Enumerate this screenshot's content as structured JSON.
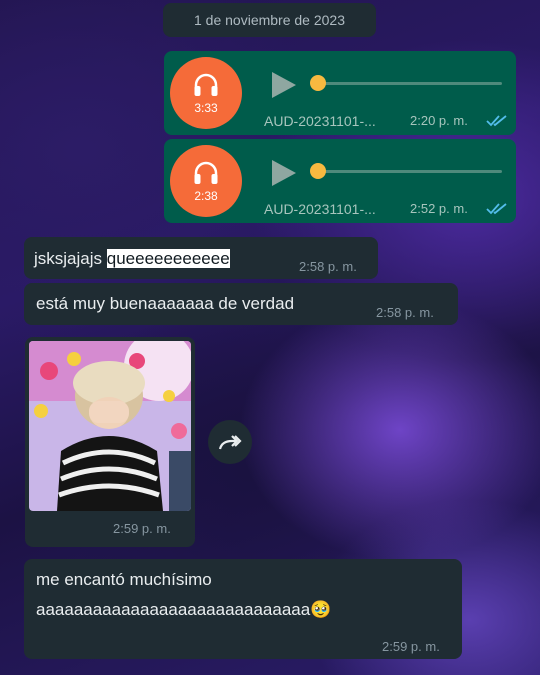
{
  "chat": {
    "date_chip": "1 de noviembre de 2023",
    "audio_messages": [
      {
        "duration": "3:33",
        "filename": "AUD-20231101-...",
        "time": "2:20 p. m.",
        "status": "read",
        "icon": "headphones-icon"
      },
      {
        "duration": "2:38",
        "filename": "AUD-20231101-...",
        "time": "2:52 p. m.",
        "status": "read",
        "icon": "headphones-icon"
      }
    ],
    "text_messages": [
      {
        "text_plain": "jsksjajajs ",
        "text_highlight": "queeeeeeeeeee",
        "time": "2:58 p. m."
      },
      {
        "text": "está muy buenaaaaaaa de verdad",
        "time": "2:58 p. m."
      }
    ],
    "image_message": {
      "time": "2:59 p. m.",
      "forward_icon": "forward-icon"
    },
    "last_message": {
      "line1": "me encantó muchísimo",
      "line2": "aaaaaaaaaaaaaaaaaaaaaaaaaaaaa",
      "emoji": "🥹",
      "time": "2:59 p. m."
    }
  },
  "colors": {
    "outgoing_bubble": "#005c4b",
    "incoming_bubble": "#1f2c33",
    "audio_avatar": "#f56b39",
    "read_ticks": "#53bdeb"
  }
}
